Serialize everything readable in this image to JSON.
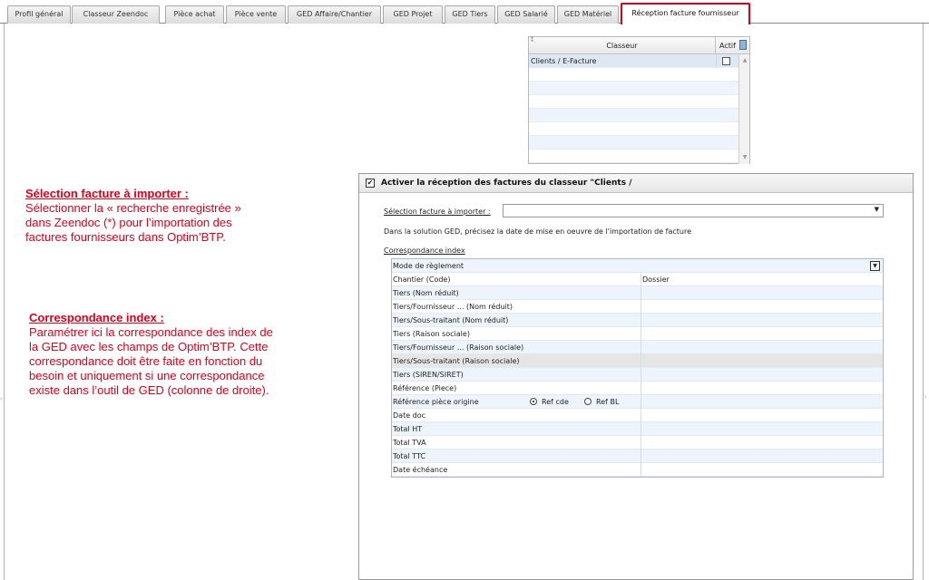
{
  "tabs": [
    {
      "label": "Profil général"
    },
    {
      "label": "Classeur Zeendoc"
    },
    {
      "label": "Pièce achat"
    },
    {
      "label": "Pièce vente"
    },
    {
      "label": "GED Affaire/Chantier"
    },
    {
      "label": "GED Projet"
    },
    {
      "label": "GED Tiers"
    },
    {
      "label": "GED Salarié"
    },
    {
      "label": "GED Matériel"
    },
    {
      "label": "Réception facture fournisseur",
      "active": true
    }
  ],
  "classeur_grid": {
    "col_classeur": "Classeur",
    "col_actif": "Actif",
    "rows": [
      {
        "classeur": "Clients / E-Facture",
        "actif": false
      }
    ]
  },
  "annotations": {
    "selection": {
      "title": "Sélection facture à importer :",
      "lines": [
        "Sélectionner la « recherche enregistrée »",
        "dans Zeendoc (*) pour l’importation des",
        "factures fournisseurs dans Optim’BTP."
      ]
    },
    "correspondance": {
      "title": "Correspondance index :",
      "lines": [
        "Paramétrer ici la correspondance des index de",
        "la GED avec les champs de Optim’BTP. Cette",
        "correspondance doit être faite en fonction du",
        "besoin et uniquement si une correspondance",
        "existe dans l’outil de GED (colonne de droite)."
      ]
    }
  },
  "panel": {
    "checkbox_checked": true,
    "title": "Activer la réception des factures du classeur \"Clients /",
    "selection_label": "Sélection facture à importer :",
    "selection_value": "",
    "info_text": "Dans la solution GED, précisez la date de mise en oeuvre de l'importation de facture",
    "corr_label": "Correspondance index",
    "index_rows": [
      {
        "field": "Mode de règlement",
        "ged": "",
        "dropdown": true
      },
      {
        "field": "Chantier (Code)",
        "ged": "Dossier"
      },
      {
        "field": "Tiers (Nom réduit)",
        "ged": ""
      },
      {
        "field": "Tiers/Fournisseur ... (Nom réduit)",
        "ged": ""
      },
      {
        "field": "Tiers/Sous-traitant (Nom réduit)",
        "ged": ""
      },
      {
        "field": "Tiers (Raison sociale)",
        "ged": ""
      },
      {
        "field": "Tiers/Fournisseur ... (Raison sociale)",
        "ged": ""
      },
      {
        "field": "Tiers/Sous-traitant (Raison sociale)",
        "ged": "",
        "highlighted": true
      },
      {
        "field": "Tiers (SIREN/SIRET)",
        "ged": ""
      },
      {
        "field": "Référence (Piece)",
        "ged": ""
      },
      {
        "field": "Référence pièce origine",
        "ged": "",
        "radios": [
          {
            "label": "Ref cde",
            "checked": true
          },
          {
            "label": "Ref BL",
            "checked": false
          }
        ]
      },
      {
        "field": "Date doc",
        "ged": ""
      },
      {
        "field": "Total HT",
        "ged": ""
      },
      {
        "field": "Total TVA",
        "ged": ""
      },
      {
        "field": "Total TTC",
        "ged": ""
      },
      {
        "field": "Date échéance",
        "ged": ""
      }
    ]
  },
  "colors": {
    "accent_red": "#e0001b",
    "row_stripe": "#eef4fb"
  },
  "icons": {
    "grid_column_icon": "column-settings-icon",
    "dropdown": "chevron-down-icon"
  }
}
